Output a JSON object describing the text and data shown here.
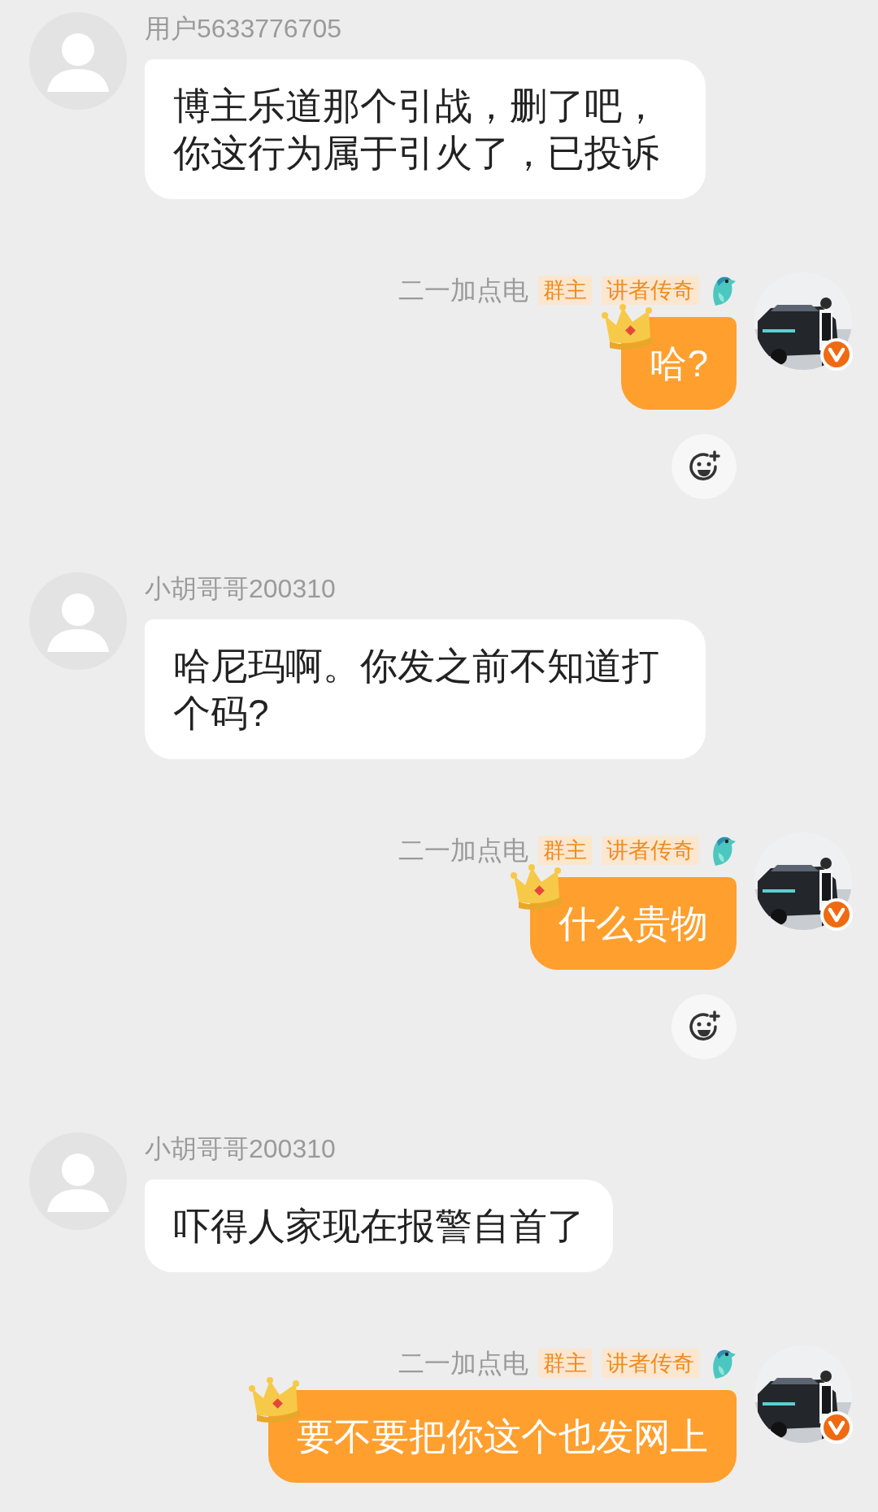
{
  "messages": [
    {
      "kind": "received",
      "sender": "用户5633776705",
      "text": "博主乐道那个引战，删了吧，你这行为属于引火了，已投诉"
    },
    {
      "kind": "sent",
      "sender": "二一加点电",
      "badges": [
        "群主",
        "讲者传奇"
      ],
      "text": "哈?",
      "reaction_button": true
    },
    {
      "kind": "received",
      "sender": "小胡哥哥200310",
      "text": "哈尼玛啊。你发之前不知道打个码?"
    },
    {
      "kind": "sent",
      "sender": "二一加点电",
      "badges": [
        "群主",
        "讲者传奇"
      ],
      "text": "什么贵物",
      "reaction_button": true
    },
    {
      "kind": "received",
      "sender": "小胡哥哥200310",
      "text": "吓得人家现在报警自首了"
    },
    {
      "kind": "sent",
      "sender": "二一加点电",
      "badges": [
        "群主",
        "讲者传奇"
      ],
      "text": "要不要把你这个也发网上",
      "reaction_button": false
    }
  ]
}
